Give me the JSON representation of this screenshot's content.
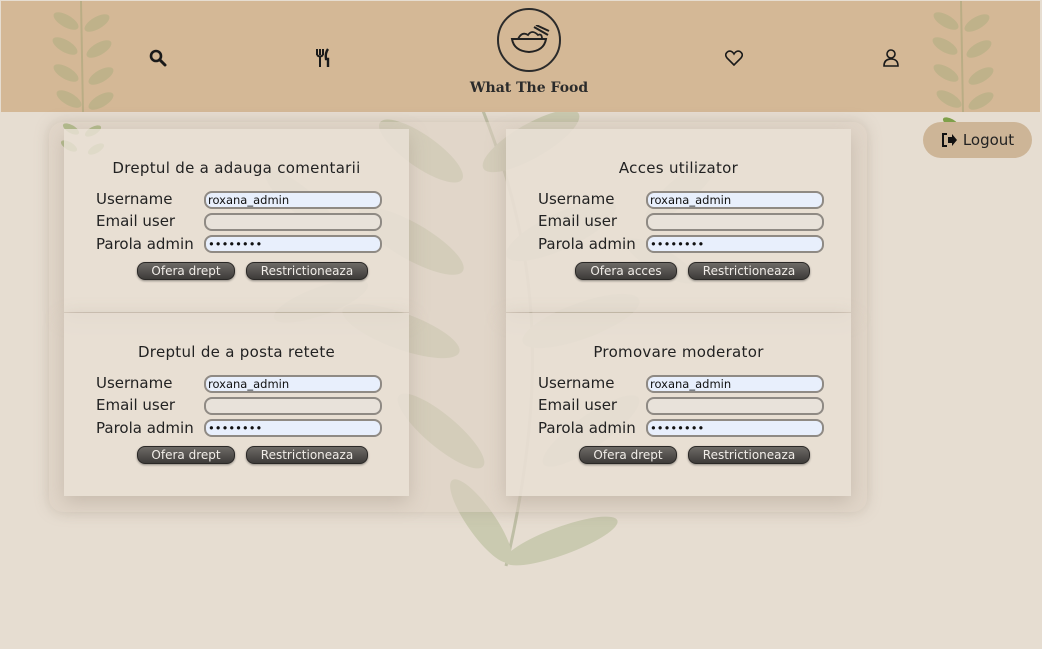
{
  "header": {
    "brand": "What The Food",
    "icons": [
      "search-icon",
      "utensils-icon",
      "heart-icon",
      "user-icon",
      "bowl-logo-icon"
    ]
  },
  "logout": {
    "label": "Logout",
    "icon": "sign-out-icon"
  },
  "labels": {
    "username": "Username",
    "email": "Email user",
    "password": "Parola admin"
  },
  "cards": [
    {
      "title": "Dreptul de a adauga comentarii",
      "username": "roxana_admin",
      "email": "",
      "password": "••••••••",
      "grant_label": "Ofera drept",
      "restrict_label": "Restrictioneaza"
    },
    {
      "title": "Acces utilizator",
      "username": "roxana_admin",
      "email": "",
      "password": "••••••••",
      "grant_label": "Ofera acces",
      "restrict_label": "Restrictioneaza"
    },
    {
      "title": "Dreptul de a posta retete",
      "username": "roxana_admin",
      "email": "",
      "password": "••••••••",
      "grant_label": "Ofera drept",
      "restrict_label": "Restrictioneaza"
    },
    {
      "title": "Promovare moderator",
      "username": "roxana_admin",
      "email": "",
      "password": "••••••••",
      "grant_label": "Ofera drept",
      "restrict_label": "Restrictioneaza"
    }
  ],
  "colors": {
    "header": "#d4b896",
    "background": "#e6ddd1",
    "button": "#4a4744"
  }
}
